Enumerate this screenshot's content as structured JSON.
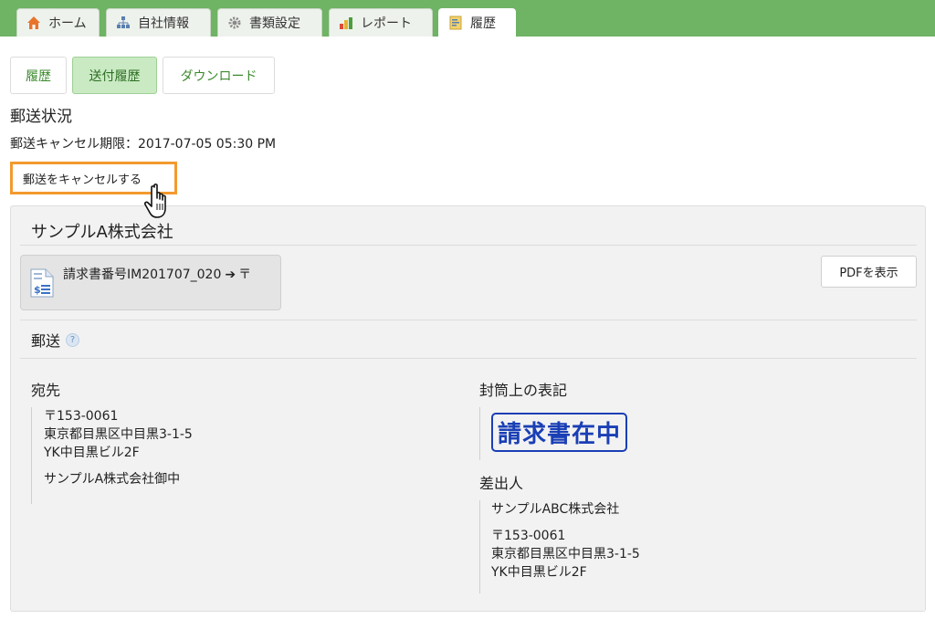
{
  "top_tabs": [
    {
      "label": "ホーム",
      "icon": "home-icon"
    },
    {
      "label": "自社情報",
      "icon": "company-icon"
    },
    {
      "label": "書類設定",
      "icon": "gear-icon"
    },
    {
      "label": "レポート",
      "icon": "bar-chart-icon"
    },
    {
      "label": "履歴",
      "icon": "history-icon",
      "active": true
    }
  ],
  "sub_tabs": [
    {
      "label": "履歴"
    },
    {
      "label": "送付履歴",
      "active": true
    },
    {
      "label": "ダウンロード"
    }
  ],
  "status": {
    "heading": "郵送状況",
    "deadline": "郵送キャンセル期限：2017-07-05 05:30 PM",
    "cancel_label": "郵送をキャンセルする"
  },
  "panel": {
    "company": "サンプルA株式会社",
    "document": {
      "name": "請求書番号IM201707_020",
      "arrow": "➔",
      "mark": "〒"
    },
    "pdf_button": "PDFを表示",
    "mail_heading": "郵送",
    "help": "?",
    "recipient": {
      "heading": "宛先",
      "postal": "〒153-0061",
      "address1": "東京都目黒区中目黒3-1-5",
      "address2": "YK中目黒ビル2F",
      "name": "サンプルA株式会社御中"
    },
    "envelope": {
      "heading": "封筒上の表記",
      "stamp": "請求書在中"
    },
    "sender": {
      "heading": "差出人",
      "name": "サンプルABC株式会社",
      "postal": "〒153-0061",
      "address1": "東京都目黒区中目黒3-1-5",
      "address2": "YK中目黒ビル2F"
    }
  },
  "colors": {
    "topbar": "#6fb364",
    "accent_green": "#3c8a2e",
    "highlight_orange": "#f39a2e",
    "stamp_blue": "#1a3fb5"
  }
}
